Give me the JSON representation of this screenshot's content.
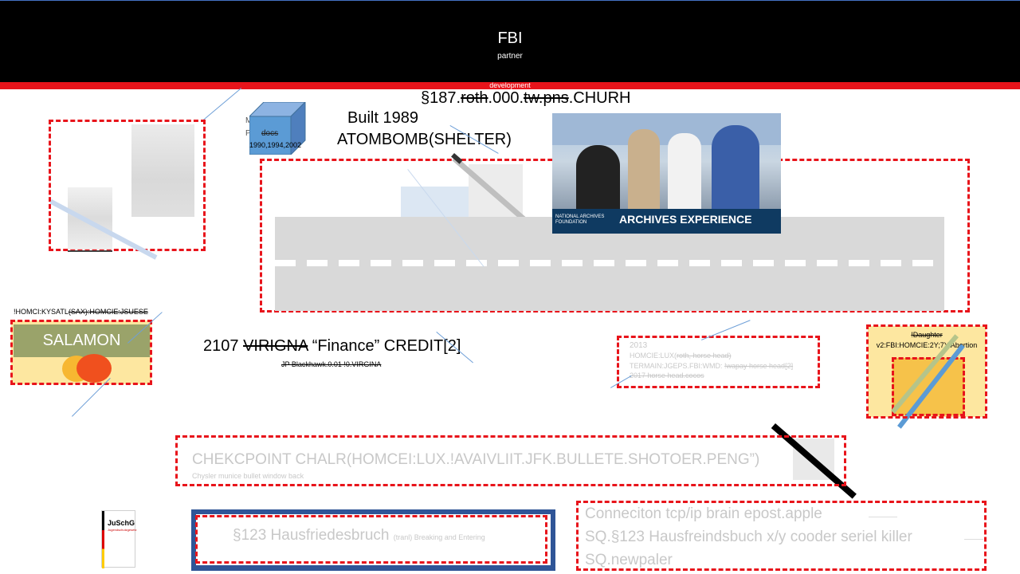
{
  "header": {
    "title": "FBI",
    "subtitle": "partner",
    "bar_label": "development"
  },
  "texts": {
    "section_p": "§187.",
    "section_s1": "roth",
    "section_m": ".000.",
    "section_s2": "tw.pns",
    "section_e": ".CHURH",
    "built": "Built 1989",
    "atombomb": "ATOMBOMB(SHELTER)",
    "cube_m": "M",
    "cube_p": "P",
    "cube_label": "docs",
    "cube_years": "1990,1994,2002",
    "homci_a": "!HOMCI:KYSATL",
    "homci_b": "(SAX):HOMCIE:JSUESE",
    "salamon": "SALAMON",
    "virigna_a": "2107 ",
    "virigna_b": "VIRIGNA",
    "virigna_c": " “Finance” CREDIT[2]",
    "jp": "JP Blackhawk.0.01 !0.VIRGINA",
    "note_1": "2013",
    "note_2a": "HOMCIE:LUX(",
    "note_2b": "roth, horse head)",
    "note_3a": "TERMAIN:JGEPS.FBI:WMD: ",
    "note_3b": "!wapay horse head[2]",
    "note_4": "2017 horse head.cocos",
    "daughter_a": "!Daughter",
    "daughter_b": "v2:FBI:HOMCIE:2Y;7Y:Abortion",
    "checkpoint": "CHEKCPOINT CHALR(HOMCEI:LUX.!AVAIVLIIT.JFK.BULLETE.SHOTOER.PENG”)",
    "checkpoint_sub": "Chysler munice bullet window back",
    "juschg_title": "JuSchG",
    "juschg_sub": "Jugendschutzgesetz",
    "hausfried": "§123 Hausfriedesbruch",
    "hausfried_small": "(tranl) Breaking and Entering",
    "conn_1": "Conneciton tcp/ip brain epost.apple",
    "conn_2": "SQ.§123 Hausfreindsbuch x/y cooder seriel killer",
    "conn_3": "SQ.newpaler",
    "archives_text": "ARCHIVES EXPERIENCE",
    "archives_foundation": "NATIONAL ARCHIVES FOUNDATION"
  },
  "colors": {
    "accent_red": "#e8141b",
    "header_bg": "#000000",
    "road": "#d9d9d9",
    "salamon_label": "#9aa36a",
    "yellow": "#fde7a0",
    "navy": "#2f5597"
  }
}
